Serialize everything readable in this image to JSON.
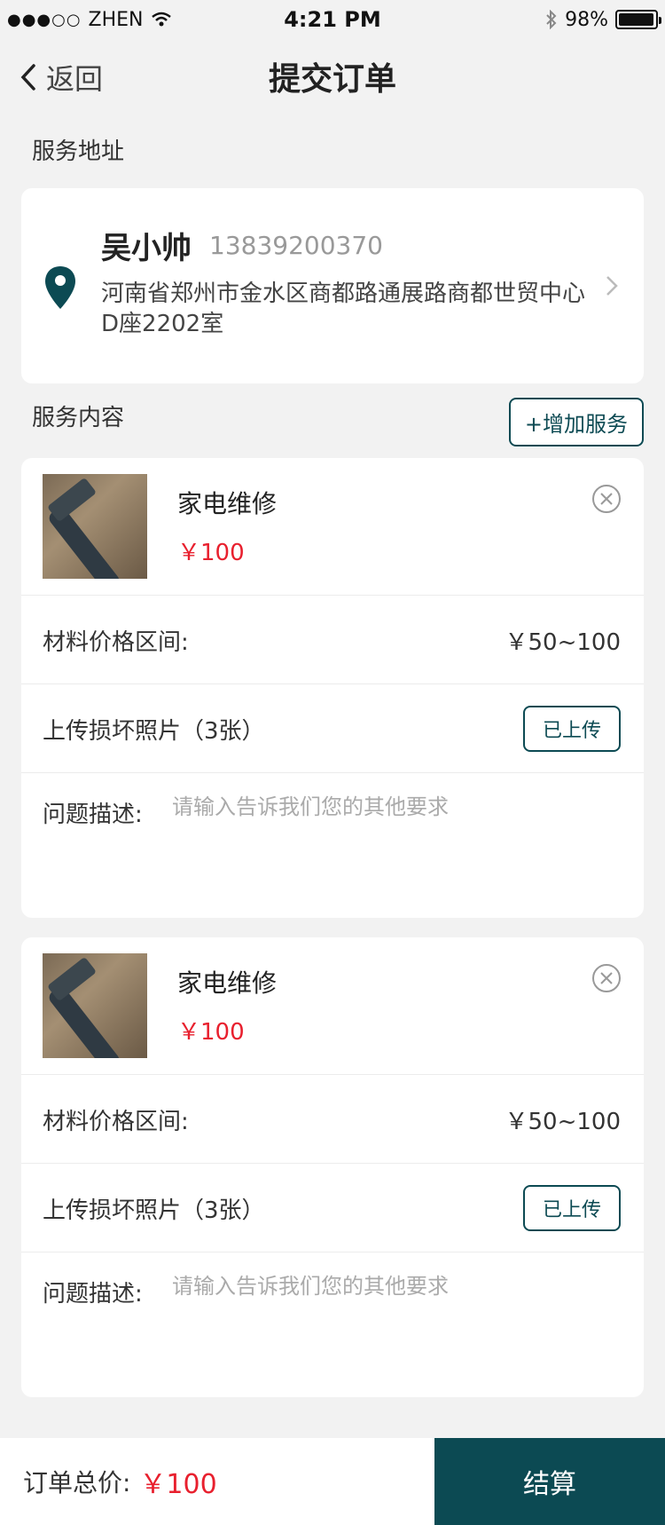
{
  "status": {
    "carrier": "ZHEN",
    "time": "4:21 PM",
    "battery": "98%",
    "battery_level": 0.98
  },
  "nav": {
    "back_label": "返回",
    "title": "提交订单"
  },
  "address": {
    "section_title": "服务地址",
    "name": "吴小帅",
    "phone": "13839200370",
    "detail": "河南省郑州市金水区商都路通展路商都世贸中心D座2202室"
  },
  "services": {
    "section_title": "服务内容",
    "add_button": "+增加服务",
    "items": [
      {
        "name": "家电维修",
        "price": "￥100",
        "material_label": "材料价格区间:",
        "material_range": "￥50~100",
        "upload_label": "上传损坏照片（3张）",
        "upload_button": "已上传",
        "desc_label": "问题描述:",
        "desc_placeholder": "请输入告诉我们您的其他要求"
      },
      {
        "name": "家电维修",
        "price": "￥100",
        "material_label": "材料价格区间:",
        "material_range": "￥50~100",
        "upload_label": "上传损坏照片（3张）",
        "upload_button": "已上传",
        "desc_label": "问题描述:",
        "desc_placeholder": "请输入告诉我们您的其他要求"
      }
    ]
  },
  "footer": {
    "total_label": "订单总价:",
    "total_value": "￥100",
    "checkout_label": "结算"
  },
  "colors": {
    "accent": "#0c4a53",
    "price": "#e8202e",
    "background": "#f2f2f2"
  }
}
